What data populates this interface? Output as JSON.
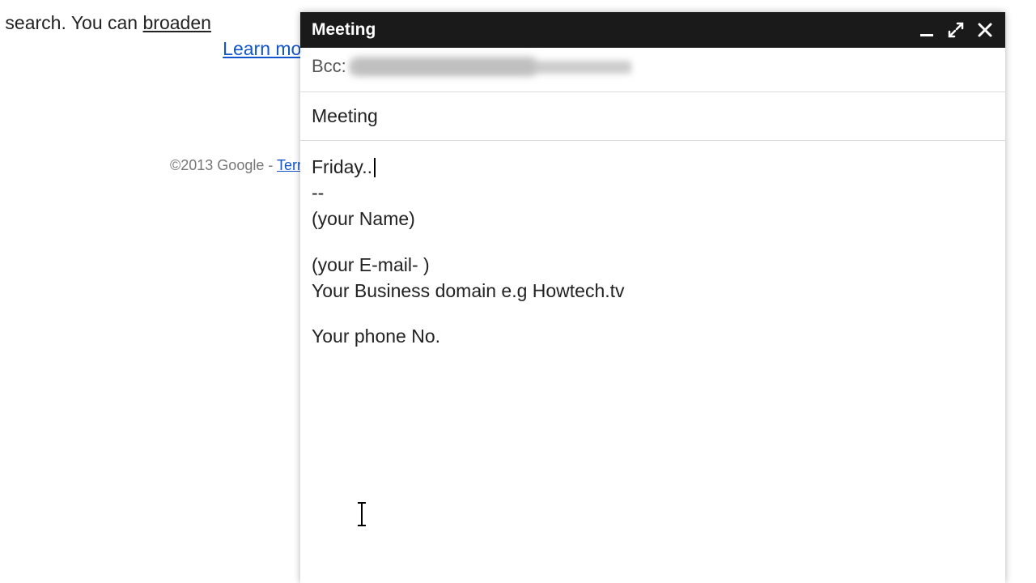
{
  "background": {
    "search_text_prefix": "es matched your search. You can ",
    "broaden_link": "broaden",
    "learn_more": "Learn mor"
  },
  "footer": {
    "copyright": "©2013 Google - ",
    "terms": "Terms"
  },
  "compose": {
    "title": "Meeting",
    "bcc_label": "Bcc:",
    "subject": "Meeting",
    "body": {
      "line1_prefix": "Friday..",
      "sig_sep": "--",
      "sig_name": "(your Name)",
      "sig_email": "(your E-mail- )",
      "sig_domain": "Your Business domain e.g Howtech.tv",
      "sig_phone": "Your phone No."
    },
    "icons": {
      "minimize": "minimize-icon",
      "fullscreen": "fullscreen-icon",
      "close": "close-icon"
    }
  }
}
